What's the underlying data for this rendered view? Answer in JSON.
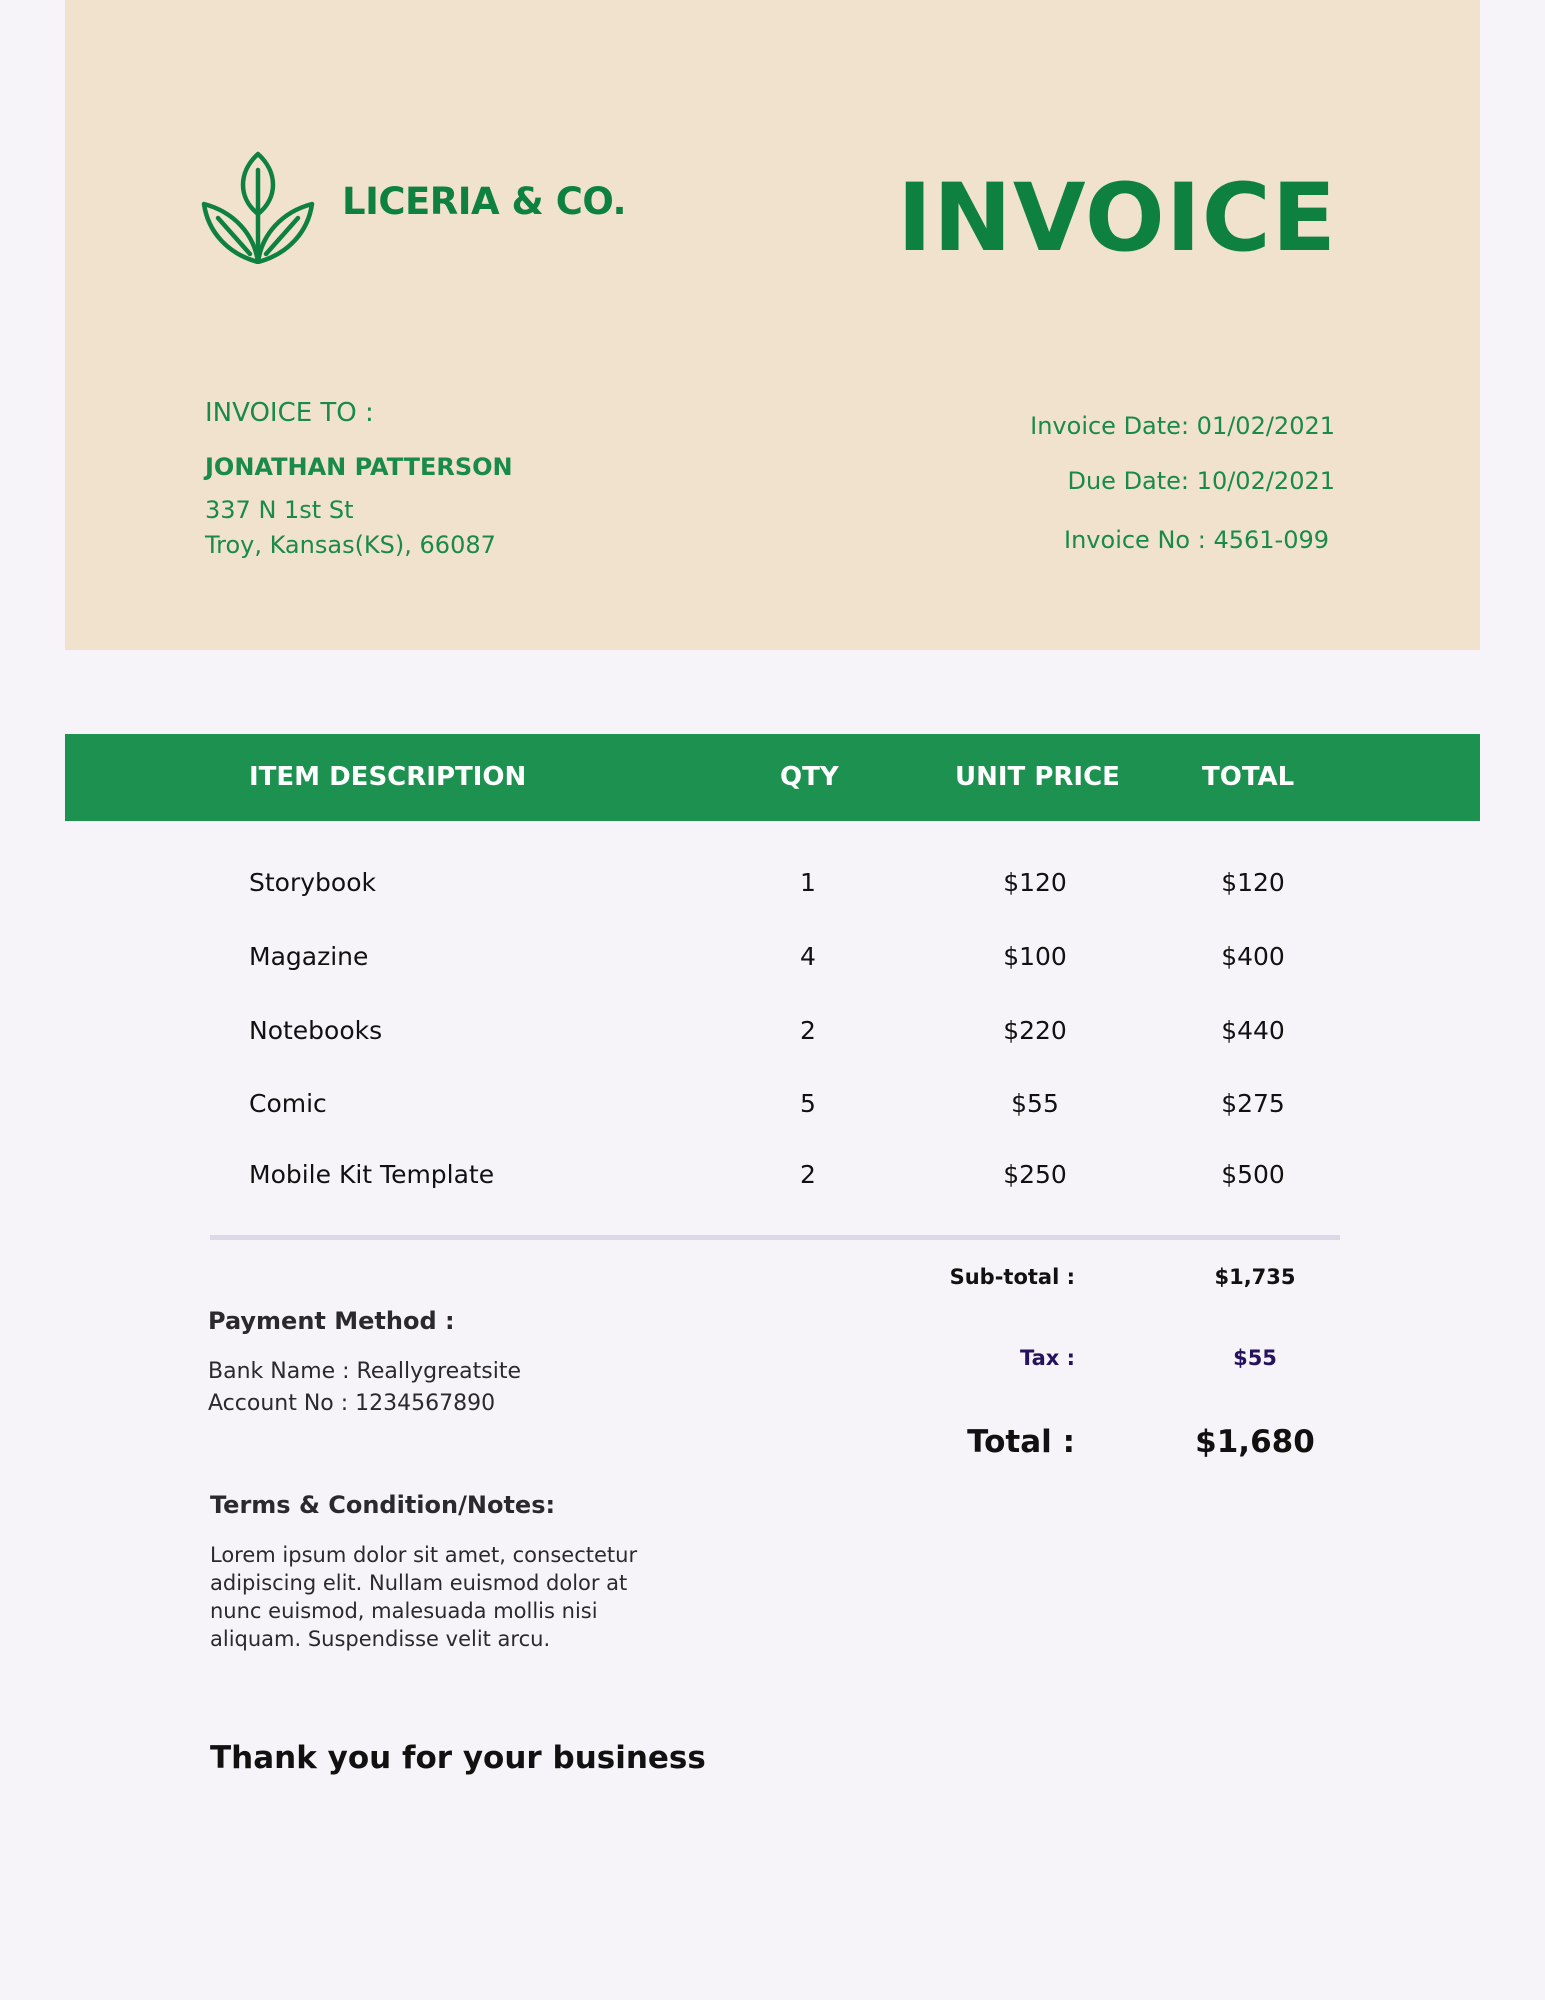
{
  "brand": {
    "logo_icon": "leaf-sprout-icon",
    "name": "LICERIA & CO."
  },
  "document_title": "INVOICE",
  "bill_to": {
    "label": "INVOICE TO :",
    "name": "JONATHAN PATTERSON",
    "address_line1": "337 N 1st St",
    "address_line2": "Troy, Kansas(KS), 66087"
  },
  "meta": {
    "invoice_date_label": "Invoice Date:",
    "invoice_date": "01/02/2021",
    "due_date_label": "Due Date:",
    "due_date": "10/02/2021",
    "invoice_no_label": "Invoice No :",
    "invoice_no": "4561-099"
  },
  "table": {
    "headers": [
      "ITEM DESCRIPTION",
      "QTY",
      "UNIT PRICE",
      "TOTAL"
    ],
    "rows": [
      {
        "description": "Storybook",
        "qty": "1",
        "unit_price": "$120",
        "total": "$120"
      },
      {
        "description": "Magazine",
        "qty": "4",
        "unit_price": "$100",
        "total": "$400"
      },
      {
        "description": "Notebooks",
        "qty": "2",
        "unit_price": "$220",
        "total": "$440"
      },
      {
        "description": "Comic",
        "qty": "5",
        "unit_price": "$55",
        "total": "$275"
      },
      {
        "description": "Mobile Kit Template",
        "qty": "2",
        "unit_price": "$250",
        "total": "$500"
      }
    ]
  },
  "summary": {
    "subtotal_label": "Sub-total :",
    "subtotal": "$1,735",
    "tax_label": "Tax :",
    "tax": "$55",
    "total_label": "Total :",
    "total": "$1,680"
  },
  "payment": {
    "title": "Payment Method :",
    "bank_name": "Bank Name : Reallygreatsite",
    "account_no": "Account No : 1234567890"
  },
  "terms": {
    "title": "Terms & Condition/Notes:",
    "body": "Lorem ipsum dolor sit amet, consectetur adipiscing elit. Nullam euismod dolor at nunc euismod, malesuada mollis nisi aliquam. Suspendisse velit arcu."
  },
  "closing": "Thank you for your business",
  "colors": {
    "header_bg": "#f0e2cd",
    "brand_green": "#0e8140",
    "table_header_bg": "#1c9150",
    "page_bg": "#f6f4f9",
    "tax_color": "#27125e"
  }
}
